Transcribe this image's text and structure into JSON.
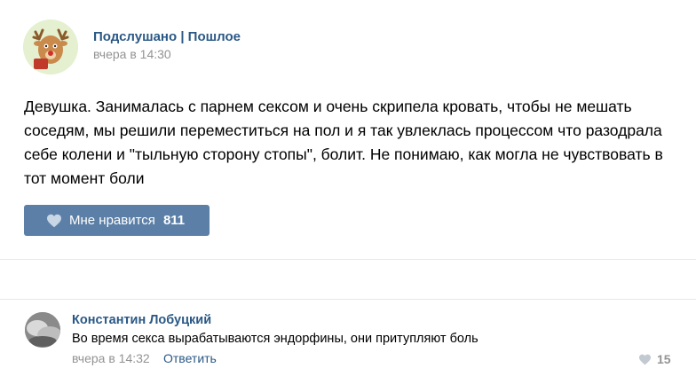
{
  "post": {
    "author": "Подслушано | Пошлое",
    "time": "вчера в 14:30",
    "text": "Девушка. Занималась с парнем сексом и очень скрипела кровать, чтобы не мешать соседям, мы решили переместиться на пол и я так увлеклась процессом что разодрала себе колени и \"тыльную сторону стопы\", болит. Не понимаю, как могла не чувствовать в тот момент боли",
    "like_label": "Мне нравится",
    "like_count": "811",
    "avatar_icon": "deer-avatar",
    "like_icon": "heart-icon"
  },
  "comment": {
    "author": "Константин Лобуцкий",
    "text": "Во время секса вырабатываются эндорфины, они притупляют боль",
    "time": "вчера в 14:32",
    "reply_label": "Ответить",
    "like_count": "15",
    "like_icon": "heart-icon"
  },
  "colors": {
    "link": "#2a5885",
    "button": "#5b7fa6",
    "muted": "#939393"
  }
}
